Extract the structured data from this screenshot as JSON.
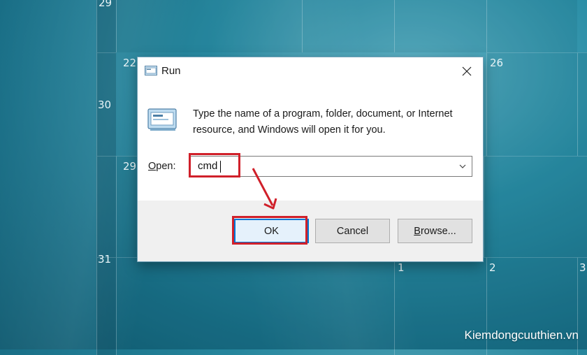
{
  "desktop": {
    "calendar_day_numbers": [
      "29",
      "22",
      "26",
      "30",
      "29",
      "31",
      "1",
      "2",
      "3"
    ],
    "watermark": "Kiemdongcuuthien.vn"
  },
  "dialog": {
    "title": "Run",
    "description": "Type the name of a program, folder, document, or Internet resource, and Windows will open it for you.",
    "open_label_accel": "O",
    "open_label_rest": "pen:",
    "open_value": "cmd",
    "buttons": {
      "ok": "OK",
      "cancel": "Cancel",
      "browse_accel": "B",
      "browse_rest": "rowse..."
    },
    "icons": {
      "title": "run-icon",
      "main": "run-icon",
      "close": "close-icon",
      "dropdown": "chevron-down-icon"
    }
  },
  "annotations": {
    "highlight_color": "#d0202a"
  }
}
